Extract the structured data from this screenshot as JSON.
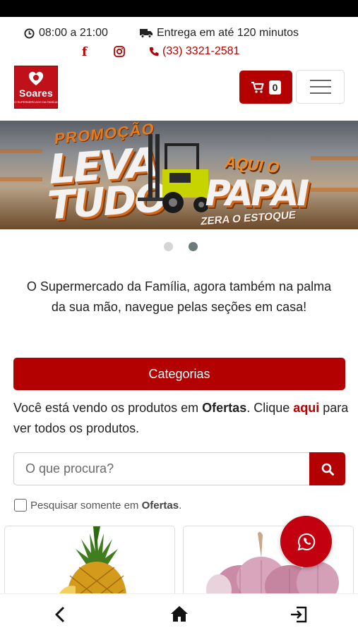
{
  "header": {
    "hours": "08:00 a 21:00",
    "delivery": "Entrega em até 120 minutos",
    "phone": "(33) 3321-2581",
    "facebook_glyph": "f"
  },
  "logo": {
    "name": "Soares",
    "tagline": "O SUPERMERCADO DA FAMÍLIA"
  },
  "cart": {
    "count": "0"
  },
  "banner": {
    "promo_line": "PROMOÇÃO",
    "title_line1": "LEVA",
    "title_line2": "TUDO",
    "aqui": "AQUI O",
    "papai": "PAPAI",
    "zera": "ZERA O ESTOQUE",
    "slide_count": 2,
    "active_slide": 2
  },
  "tagline": "O Supermercado da Família, agora também na palma da sua mão, navegue pelas seções em casa!",
  "categories_button": "Categorias",
  "viewing": {
    "prefix": "Você está vendo os produtos em ",
    "section": "Ofertas",
    "middle": ". Clique ",
    "link": "aqui",
    "suffix": " para ver todos os produtos."
  },
  "search": {
    "placeholder": "O que procura?",
    "only_prefix": "Pesquisar somente em ",
    "only_section": "Ofertas",
    "only_suffix": "."
  },
  "products": [
    {
      "image": "pineapple"
    },
    {
      "image": "garlic"
    }
  ],
  "colors": {
    "brand": "#b30000",
    "whatsapp": "#c3000f"
  },
  "icons": [
    "clock-icon",
    "truck-icon",
    "facebook-icon",
    "instagram-icon",
    "phone-icon",
    "cart-icon",
    "hamburger-icon",
    "search-icon",
    "whatsapp-icon",
    "back-icon",
    "home-icon",
    "exit-icon"
  ]
}
